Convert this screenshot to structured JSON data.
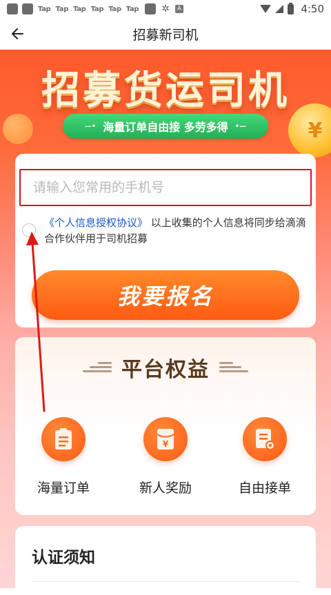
{
  "status_bar": {
    "tap_labels": [
      "Tap",
      "Tap",
      "Tap",
      "Tap",
      "Tap",
      "Tap"
    ],
    "time": "4:50",
    "a_badge": "A"
  },
  "header": {
    "back_icon": "arrow-left-icon",
    "title": "招募新司机"
  },
  "banner": {
    "title": "招募货运司机",
    "pill_text": "海量订单自由接 多劳多得",
    "coin_symbol": "¥"
  },
  "form": {
    "phone_placeholder": "请输入您常用的手机号",
    "phone_value": "",
    "agreement_link": "《个人信息授权协议》",
    "agreement_text": "以上收集的个人信息将同步给滴滴合作伙伴用于司机招募",
    "agree_checked": false,
    "signup_label": "我要报名"
  },
  "benefits": {
    "title": "平台权益",
    "items": [
      {
        "label": "海量订单",
        "icon": "clipboard-icon"
      },
      {
        "label": "新人奖励",
        "icon": "red-envelope-icon"
      },
      {
        "label": "自由接单",
        "icon": "document-icon"
      }
    ]
  },
  "cert": {
    "title": "认证须知"
  },
  "colors": {
    "accent": "#ff5a13",
    "link": "#1a56c9",
    "input_border": "#d8141e",
    "pill": "#21b056"
  }
}
